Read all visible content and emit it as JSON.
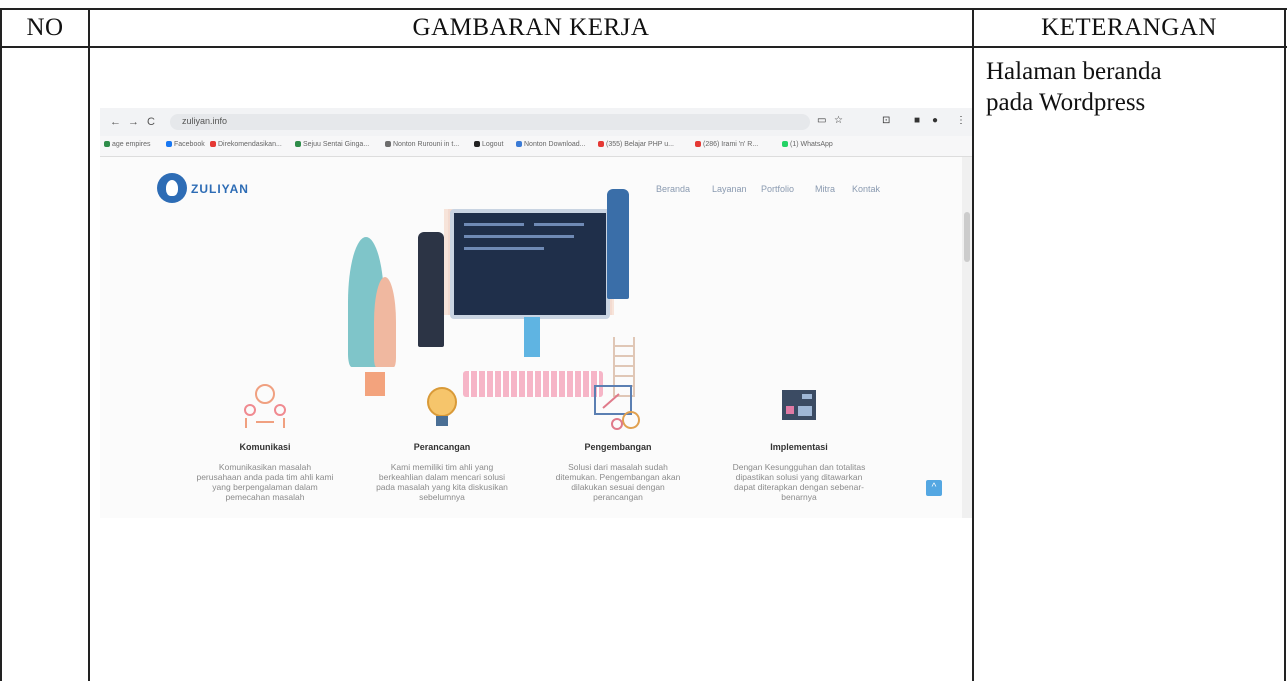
{
  "table": {
    "headers": {
      "no": "NO",
      "gambaran": "GAMBARAN KERJA",
      "keterangan": "KETERANGAN"
    },
    "row": {
      "keterangan_lines": [
        "Halaman beranda",
        "pada Wordpress"
      ]
    }
  },
  "screenshot": {
    "browser": {
      "url": "zuliyan.info",
      "bookmarks": [
        "age empires",
        "Facebook",
        "Direkomendasikan...",
        "Sejuu Sentai Ginga...",
        "Nonton Rurouni in t...",
        "Logout",
        "Nonton Download...",
        "(355) Belajar PHP u...",
        "(286) Irami 'n' R...",
        "(1) WhatsApp"
      ]
    },
    "site": {
      "logo": "ZULIYAN",
      "menu": [
        "Beranda",
        "Layanan",
        "Portfolio",
        "Mitra",
        "Kontak"
      ],
      "features": [
        {
          "title": "Komunikasi",
          "icon": "communication-icon",
          "desc": [
            "Komunikasikan masalah",
            "perusahaan anda pada tim ahli kami",
            "yang berpengalaman dalam",
            "pemecahan masalah"
          ]
        },
        {
          "title": "Perancangan",
          "icon": "lightbulb-icon",
          "desc": [
            "Kami memiliki tim ahli yang",
            "berkeahlian dalam mencari solusi",
            "pada masalah yang kita diskusikan",
            "sebelumnya"
          ]
        },
        {
          "title": "Pengembangan",
          "icon": "settings-design-icon",
          "desc": [
            "Solusi dari masalah sudah",
            "ditemukan. Pengembangan akan",
            "dilakukan sesuai dengan",
            "perancangan"
          ]
        },
        {
          "title": "Implementasi",
          "icon": "code-screen-icon",
          "desc": [
            "Dengan Kesungguhan dan totalitas",
            "dipastikan solusi yang ditawarkan",
            "dapat diterapkan dengan sebenar-",
            "benarnya"
          ]
        }
      ],
      "accent": "#2d6cb5"
    }
  }
}
